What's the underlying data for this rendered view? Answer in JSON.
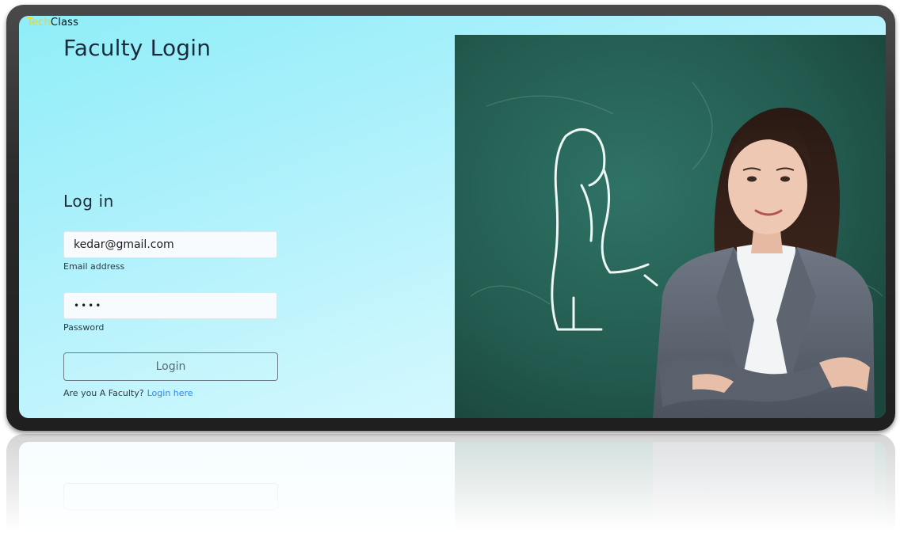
{
  "app": {
    "brand_part1": "Tech",
    "brand_part2": "Class",
    "brand_color_part1": "#f2d21b",
    "brand_color_part2": "#111111"
  },
  "page": {
    "title": "Faculty Login",
    "subtitle": "Log in"
  },
  "form": {
    "email_value": "kedar@gmail.com",
    "email_label": "Email address",
    "password_value": "••••",
    "password_label": "Password",
    "login_button": "Login",
    "helper_text": "Are you A Faculty?",
    "helper_link": "Login here"
  },
  "hero": {
    "image_alt": "teacher-in-front-of-chalkboard-photo"
  },
  "colors": {
    "accent_link": "#2f86e8",
    "background_gradient_start": "#8feef8",
    "chalkboard": "#22574d"
  }
}
